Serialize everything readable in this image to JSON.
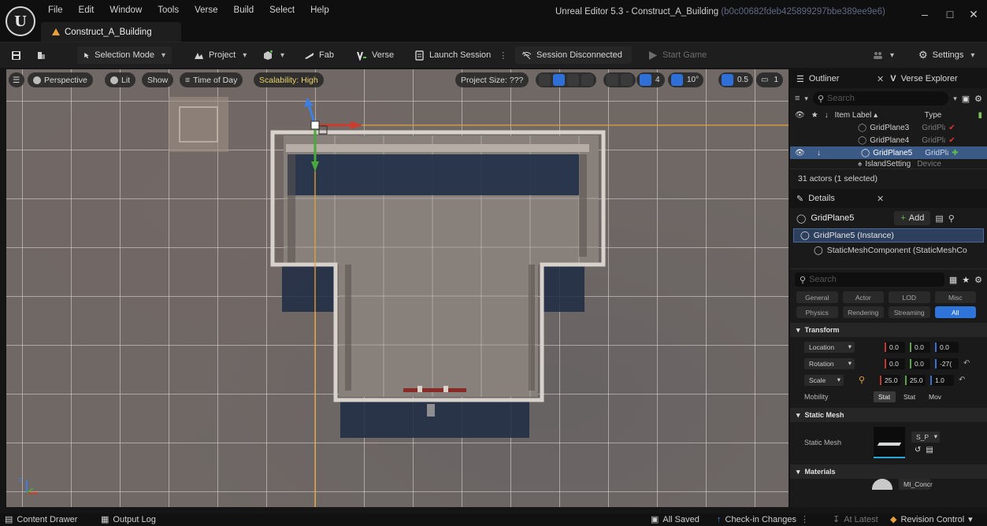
{
  "app": {
    "logo_text": "U",
    "title": "Unreal Editor 5.3 - Construct_A_Building",
    "title_hash": "(b0c00682fdeb425899297bbe389ee9e6)",
    "project_tab": "Construct_A_Building"
  },
  "menu": [
    "File",
    "Edit",
    "Window",
    "Tools",
    "Verse",
    "Build",
    "Select",
    "Help"
  ],
  "window_controls": [
    "–",
    "□",
    "✕"
  ],
  "toolbar": {
    "selection_mode": "Selection Mode",
    "project": "Project",
    "fab": "Fab",
    "verse": "Verse",
    "launch_session": "Launch Session",
    "session_status": "Session Disconnected",
    "start_game": "Start Game",
    "settings": "Settings"
  },
  "viewport": {
    "perspective": "Perspective",
    "lit": "Lit",
    "show": "Show",
    "time_of_day": "Time of Day",
    "scalability": "Scalability: High",
    "project_size": "Project Size: ???",
    "grid_value": "4",
    "rot_snap": "10°",
    "scale_snap": "0.5",
    "camera": "1",
    "axis_z": "z"
  },
  "outliner": {
    "tab_title": "Outliner",
    "verse_tab": "Verse Explorer",
    "search_placeholder": "Search",
    "col_label": "Item Label ▴",
    "col_type": "Type",
    "rows": [
      {
        "label": "GridPlane3",
        "type": "GridPlai"
      },
      {
        "label": "GridPlane4",
        "type": "GridPlai"
      },
      {
        "label": "GridPlane5",
        "type": "GridPlai"
      },
      {
        "label": "IslandSetting",
        "type": "Device"
      }
    ],
    "actor_count": "31 actors (1 selected)"
  },
  "details": {
    "tab_title": "Details",
    "object_name": "GridPlane5",
    "add_label": "Add",
    "instance": "GridPlane5 (Instance)",
    "component": "StaticMeshComponent (StaticMeshCo",
    "search_placeholder": "Search",
    "filters_row1": [
      "General",
      "Actor",
      "LOD",
      "Misc"
    ],
    "filters_row2": [
      "Physics",
      "Rendering",
      "Streaming",
      "All"
    ],
    "transform_header": "Transform",
    "location_label": "Location",
    "location": [
      "0.0",
      "0.0",
      "0.0"
    ],
    "rotation_label": "Rotation",
    "rotation": [
      "0.0",
      "0.0",
      "-27("
    ],
    "scale_label": "Scale",
    "scale": [
      "25.0",
      "25.0",
      "1.0"
    ],
    "mobility_label": "Mobility",
    "mobility_options": [
      "Stat",
      "Stat",
      "Mov"
    ],
    "static_mesh_header": "Static Mesh",
    "static_mesh_label": "Static Mesh",
    "mesh_name": "S_P",
    "materials_header": "Materials",
    "material_name": "MI_Concr"
  },
  "statusbar": {
    "content_drawer": "Content Drawer",
    "output_log": "Output Log",
    "all_saved": "All Saved",
    "checkin": "Check-in Changes",
    "at_latest": "At Latest",
    "revision_control": "Revision Control"
  },
  "colors": {
    "accent_blue": "#2f74d8",
    "selection_orange": "#e8a13a",
    "axis_red": "#d03a2a",
    "axis_green": "#49a83c",
    "axis_blue": "#3d7ee0"
  }
}
